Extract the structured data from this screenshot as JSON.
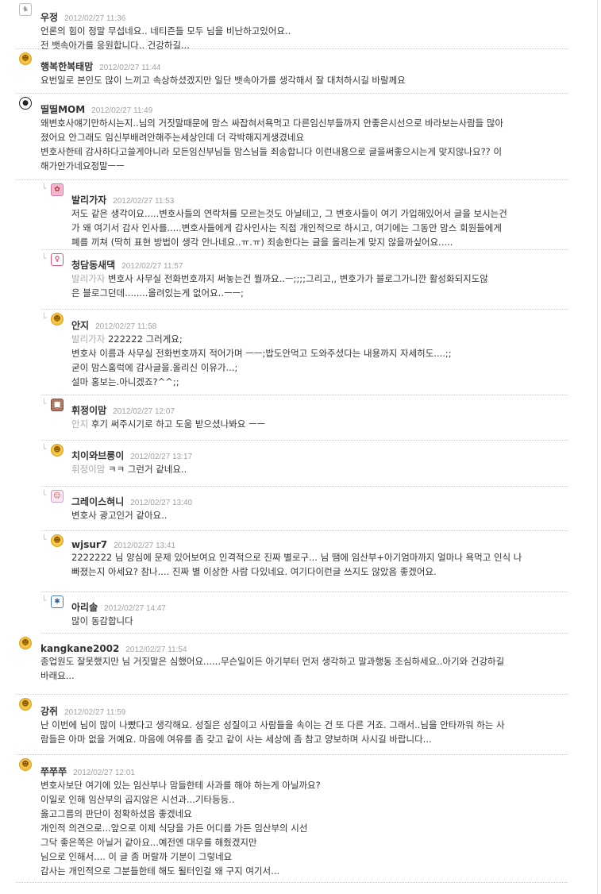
{
  "comments": [
    {
      "name": "우정",
      "date": "2012/02/27 11:36",
      "avatar": "unicorn-icon",
      "body": "언론의 힘이 정말 무섭네요.. 네티즌들 모두 님을 비난하고있어요..\n전 뱃속아가를 응원합니다.. 건강하길..."
    },
    {
      "name": "행복한복태맘",
      "date": "2012/02/27 11:44",
      "avatar": "smiley-icon",
      "body": "요번일로 본인도 많이 느끼고 속상하셨겠지만 일단 뱃속아가를 생각해서 잘 대처하시길 바랄께요"
    },
    {
      "name": "띨띨MOM",
      "date": "2012/02/27 11:49",
      "avatar": "panda-icon",
      "body": "왜변호사얘기만하시는지..님의 거짓말때문에 맘스 싸잡혀서욕먹고 다른임신부들까지 안좋은시선으로 바라보는사람들 많아\n졌어요 안그래도 임신부배려안해주는세상인데 더 각박해지게생겼네요\n변호사한테 감사하다고쓸게아니라 모든임신부님들 맘스님들 죄송합니다 이런내용으로 글을써좋으시는게 맞지않나요?? 이\n해가안가네요정말ㅡㅡ"
    }
  ],
  "replies": [
    {
      "name": "발리가자",
      "date": "2012/02/27 11:53",
      "avatar": "flower-icon",
      "mention": "",
      "body": "저도 같은 생각이요.....변호사들의 연락처를 모르는것도 아닐테고, 그 변호사들이 여기 가입해있어서 글을 보시는건\n가 왜 여기서 감사 인사를.....변호사들에게 감사인사는 직접 개인적으로 하시고, 여기에는 그동안 맘스 회원들에게\n폐를 끼쳐 (딱히 표현 방법이 생각 안나네요..ㅠ.ㅠ) 죄송한다는 글을 올리는게 맞지 않을까싶어요....."
    },
    {
      "name": "청담동새댁",
      "date": "2012/02/27 11:57",
      "avatar": "girl-icon",
      "mention": "발리가자",
      "body": " 변호사 사무실 전화번호까지 써놓는건 뭘까요..ㅡ;;;;그리고,, 변호가가 블로그가니깐 활성화되지도않\n은 블로그던데........올려있는게 없어요..ㅡㅡ;"
    },
    {
      "name": "안지",
      "date": "2012/02/27 11:58",
      "avatar": "smiley-icon",
      "mention": "발리가자",
      "body": " 222222 그러게요;\n변호사 이름과 사무실 전화번호까지 적어가며 ㅡㅡ;밥도안먹고 도와주셨다는 내용까지 자세히도....;;\n굳이 맘스홈럭에 감사글을.올리신 이유가...;\n설마 홍보는.아니겠죠?^^;;"
    },
    {
      "name": "휘정이맘",
      "date": "2012/02/27 12:07",
      "avatar": "photo-icon",
      "mention": "안지",
      "body": " 후기 써주시기로 하고 도움 받으셨나봐요 ㅡㅡ"
    },
    {
      "name": "치이와브룽이",
      "date": "2012/02/27 13:17",
      "avatar": "smiley-icon",
      "mention": "휘정이맘",
      "body": " ㅋㅋ 그런거 같네요.."
    },
    {
      "name": "그레이스혀니",
      "date": "2012/02/27 13:40",
      "avatar": "cat-icon",
      "mention": "",
      "body": "변호사 광고인거 같아요.."
    },
    {
      "name": "wjsur7",
      "date": "2012/02/27 13:41",
      "avatar": "smiley-icon",
      "mention": "",
      "body": "2222222 님 양심에 문제 있어보여요 인격적으로 진짜 별로구... 님 땜에 임산부+아기엄마까지 얼마나 욕먹고 인식 나\n빠졌는지 아세요? 참나.... 진짜 별 이상한 사람 다있네요. 여기다이런글 쓰지도 않았음 좋겠어요."
    },
    {
      "name": "아리솔",
      "date": "2012/02/27 14:47",
      "avatar": "coral-icon",
      "mention": "",
      "body": "많이 동감합니다"
    }
  ],
  "comments_after": [
    {
      "name": "kangkane2002",
      "date": "2012/02/27 11:54",
      "avatar": "smiley-icon",
      "body": "종업원도 잘못했지만 님 거짓말은 심했어요......무슨일이든 아기부터 먼저 생각하고 말과행동 조심하세요..아기와 건강하길\n바래요..."
    },
    {
      "name": "강쥐",
      "date": "2012/02/27 11:59",
      "avatar": "smiley-icon",
      "body": "난 이번에 님이 많이 나빴다고 생각해요. 성질은 성질이고 사람들을 속이는 건 또 다른 거죠. 그래서..님을 안타까워 하는 사\n람들은 아마 없을 거예요. 마음에 여유를 좀 갖고 같이 사는 세상에 좀 참고 양보하며 사시길 바랍니다..."
    },
    {
      "name": "쭈쭈쭈",
      "date": "2012/02/27 12:01",
      "avatar": "smiley-icon",
      "body": "변호사보단 여기에 있는 임산부나 맘들한테 사과를 해야 하는게 아닐까요?\n이일로 인해 임산부의 곱지않은 시선과...기타등등..\n옳고그름의 판단이 정확하셨음 좋겠네요\n개인적 의견으로...앞으로 이제 식당을 가든 어디를 가든 임산부의 시선\n그닥 좋은쪽은 아닐거 같아요...예전엔 대우를 해줬겠지만\n님으로 인해서.... 이 글 좀 머랄까 기분이 그렇네요\n감사는 개인적으로 그분들한테 해도 될터인걸 왜 구지 여기서..."
    }
  ]
}
